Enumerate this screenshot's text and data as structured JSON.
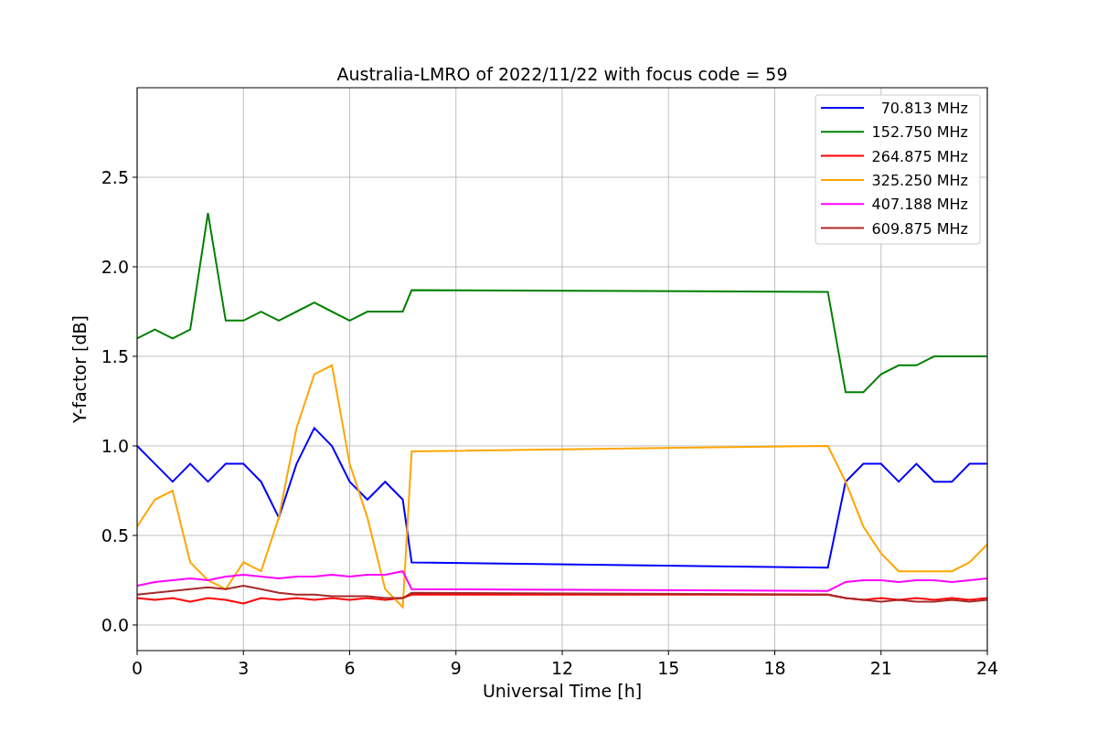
{
  "figure": {
    "chart_data": {
      "type": "line",
      "title": "Australia-LMRO of 2022/11/22 with focus code = 59",
      "xlabel": "Universal Time [h]",
      "ylabel": "Y-factor [dB]",
      "x": [
        0,
        0.5,
        1,
        1.5,
        2,
        2.5,
        3,
        3.5,
        4,
        4.5,
        5,
        5.5,
        6,
        6.5,
        7,
        7.5,
        7.75,
        19.5,
        20,
        20.5,
        21,
        21.5,
        22,
        22.5,
        23,
        23.5,
        24
      ],
      "xlim": [
        0,
        24
      ],
      "ylim": [
        -0.143,
        3.0
      ],
      "grid": true,
      "legend": true,
      "xticks": [
        0,
        3,
        6,
        9,
        12,
        15,
        18,
        21,
        24
      ],
      "yticks": [
        {
          "value": 0,
          "label": "0.0"
        },
        {
          "value": 0.5,
          "label": "0.5"
        },
        {
          "value": 1,
          "label": "1.0"
        },
        {
          "value": 1.5,
          "label": "1.5"
        },
        {
          "value": 2,
          "label": "2.0"
        },
        {
          "value": 2.5,
          "label": "2.5"
        }
      ],
      "series": [
        {
          "name": "70.813 MHz",
          "color": "#0000ff",
          "values": [
            1.0,
            0.9,
            0.8,
            0.9,
            0.8,
            0.9,
            0.9,
            0.8,
            0.6,
            0.9,
            1.1,
            1.0,
            0.8,
            0.7,
            0.8,
            0.7,
            0.35,
            0.32,
            0.8,
            0.9,
            0.9,
            0.8,
            0.9,
            0.8,
            0.8,
            0.9,
            0.9
          ]
        },
        {
          "name": "152.750 MHz",
          "color": "#008000",
          "values": [
            1.6,
            1.65,
            1.6,
            1.65,
            2.3,
            1.7,
            1.7,
            1.75,
            1.7,
            1.75,
            1.8,
            1.75,
            1.7,
            1.75,
            1.75,
            1.75,
            1.87,
            1.86,
            1.3,
            1.3,
            1.4,
            1.45,
            1.45,
            1.5,
            1.5,
            1.5,
            1.5
          ]
        },
        {
          "name": "264.875 MHz",
          "color": "#ff0000",
          "values": [
            0.15,
            0.14,
            0.15,
            0.13,
            0.15,
            0.14,
            0.12,
            0.15,
            0.14,
            0.15,
            0.14,
            0.15,
            0.14,
            0.15,
            0.14,
            0.15,
            0.17,
            0.17,
            0.15,
            0.14,
            0.15,
            0.14,
            0.15,
            0.14,
            0.15,
            0.14,
            0.15
          ]
        },
        {
          "name": "325.250 MHz",
          "color": "#ffa500",
          "values": [
            0.55,
            0.7,
            0.75,
            0.35,
            0.25,
            0.2,
            0.35,
            0.3,
            0.6,
            1.1,
            1.4,
            1.45,
            0.9,
            0.6,
            0.2,
            0.1,
            0.97,
            1.0,
            0.8,
            0.55,
            0.4,
            0.3,
            0.3,
            0.3,
            0.3,
            0.35,
            0.45
          ]
        },
        {
          "name": "407.188 MHz",
          "color": "#ff00ff",
          "values": [
            0.22,
            0.24,
            0.25,
            0.26,
            0.25,
            0.27,
            0.28,
            0.27,
            0.26,
            0.27,
            0.27,
            0.28,
            0.27,
            0.28,
            0.28,
            0.3,
            0.2,
            0.19,
            0.24,
            0.25,
            0.25,
            0.24,
            0.25,
            0.25,
            0.24,
            0.25,
            0.26
          ]
        },
        {
          "name": "609.875 MHz",
          "color": "#a52a2a",
          "values": [
            0.17,
            0.18,
            0.19,
            0.2,
            0.21,
            0.2,
            0.22,
            0.2,
            0.18,
            0.17,
            0.17,
            0.16,
            0.16,
            0.16,
            0.15,
            0.15,
            0.18,
            0.17,
            0.15,
            0.14,
            0.13,
            0.14,
            0.13,
            0.13,
            0.14,
            0.13,
            0.14
          ]
        }
      ]
    }
  }
}
